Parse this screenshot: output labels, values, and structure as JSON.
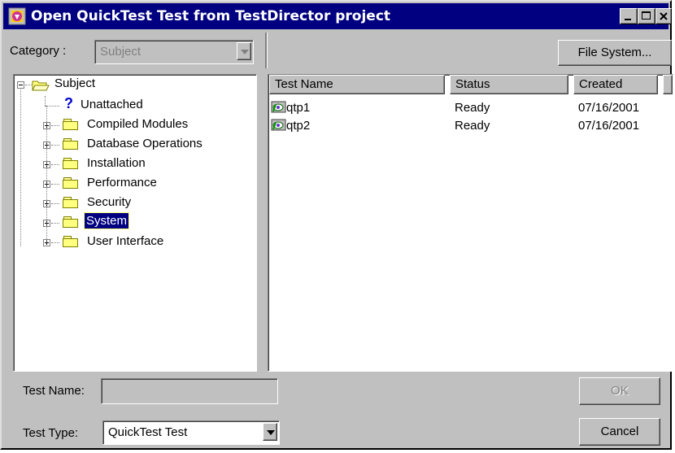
{
  "window": {
    "title": "Open QuickTest Test from TestDirector project"
  },
  "toolbar": {
    "category_label": "Category :",
    "category_value": "Subject",
    "file_system_button": "File System..."
  },
  "tree": {
    "root": "Subject",
    "items": [
      {
        "label": "Unattached",
        "icon": "question-icon"
      },
      {
        "label": "Compiled Modules",
        "icon": "folder-icon"
      },
      {
        "label": "Database Operations",
        "icon": "folder-icon"
      },
      {
        "label": "Installation",
        "icon": "folder-icon"
      },
      {
        "label": "Performance",
        "icon": "folder-icon"
      },
      {
        "label": "Security",
        "icon": "folder-icon"
      },
      {
        "label": "System",
        "icon": "folder-icon",
        "selected": true
      },
      {
        "label": "User Interface",
        "icon": "folder-icon"
      }
    ]
  },
  "list": {
    "columns": [
      "Test Name",
      "Status",
      "Created"
    ],
    "rows": [
      {
        "name": "qtp1",
        "status": "Ready",
        "created": "07/16/2001"
      },
      {
        "name": "qtp2",
        "status": "Ready",
        "created": "07/16/2001"
      }
    ]
  },
  "form": {
    "test_name_label": "Test Name:",
    "test_name_value": "",
    "test_type_label": "Test Type:",
    "test_type_value": "QuickTest Test",
    "ok_button": "OK",
    "cancel_button": "Cancel"
  },
  "colors": {
    "title_bar": "#000080",
    "selection": "#000080",
    "dialog_face": "#c0c0c0"
  }
}
